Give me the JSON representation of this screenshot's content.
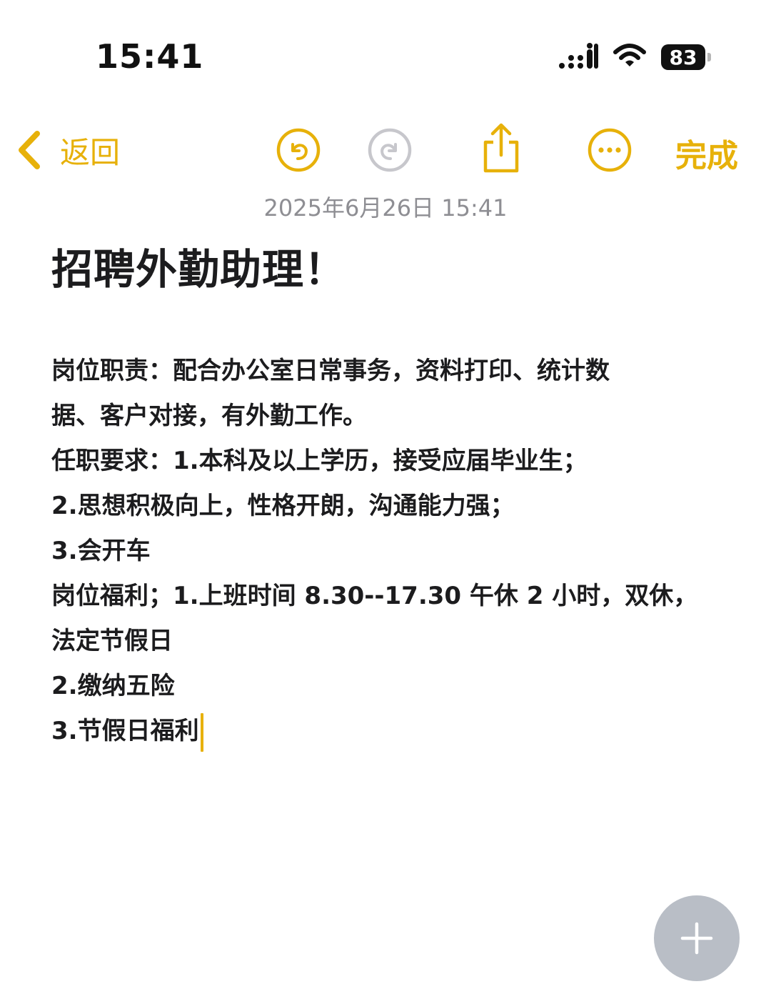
{
  "status_bar": {
    "time": "15:41",
    "battery_level": "83",
    "icons": [
      "cellular-signal-icon",
      "wifi-icon",
      "battery-icon"
    ]
  },
  "nav": {
    "back_label": "返回",
    "done_label": "完成",
    "icons": [
      "chevron-left-icon",
      "undo-icon",
      "redo-icon",
      "share-icon",
      "more-icon"
    ]
  },
  "note": {
    "date": "2025年6月26日 15:41",
    "title": "招聘外勤助理！",
    "lines": [
      "岗位职责：配合办公室日常事务，资料打印、统计数",
      "据、客户对接，有外勤工作。",
      "任职要求：1.本科及以上学历，接受应届毕业生；",
      "2.思想积极向上，性格开朗，沟通能力强；",
      "3.会开车",
      "岗位福利；1.上班时间 8.30--17.30 午休 2 小时，双休，",
      "法定节假日",
      "2.缴纳五险",
      "3.节假日福利"
    ]
  },
  "fab": {
    "icon": "plus-icon"
  },
  "colors": {
    "accent": "#e7b10a",
    "disabled": "#c7c7cc",
    "fab": "#b9bec6",
    "date_text": "#8e8e93"
  }
}
